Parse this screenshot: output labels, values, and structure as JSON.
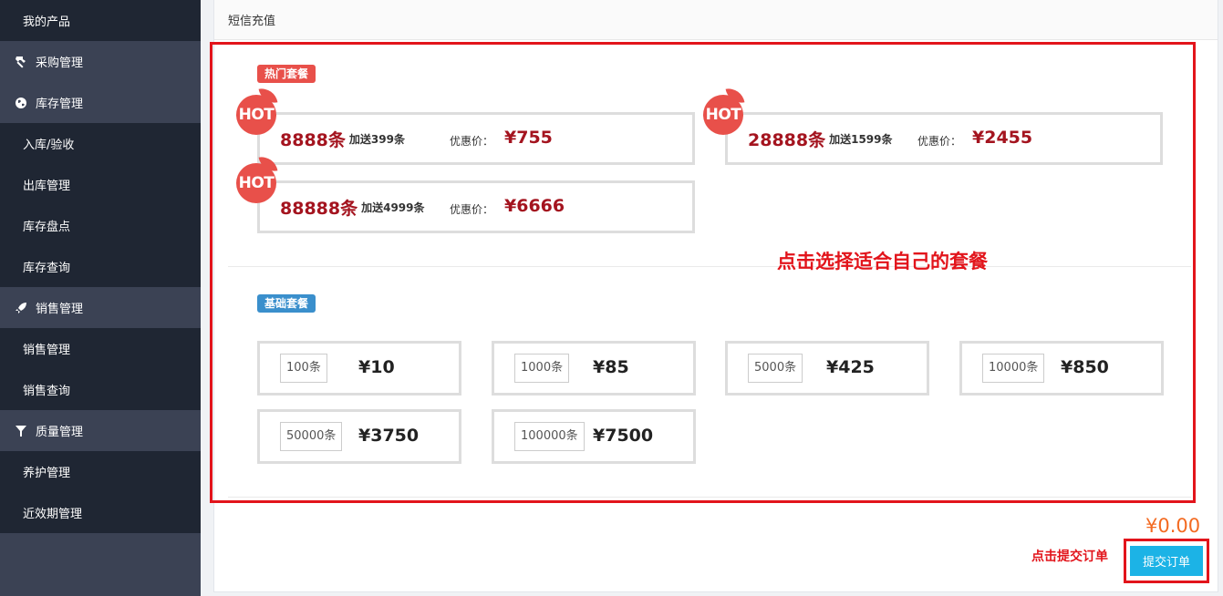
{
  "sidebar": {
    "items": [
      {
        "label": "我的产品",
        "kind": "sub"
      },
      {
        "label": "采购管理",
        "kind": "group",
        "icon": "hammer-icon"
      },
      {
        "label": "库存管理",
        "kind": "group",
        "icon": "globe-icon"
      },
      {
        "label": "入库/验收",
        "kind": "sub"
      },
      {
        "label": "出库管理",
        "kind": "sub"
      },
      {
        "label": "库存盘点",
        "kind": "sub"
      },
      {
        "label": "库存查询",
        "kind": "sub"
      },
      {
        "label": "销售管理",
        "kind": "group",
        "icon": "rocket-icon"
      },
      {
        "label": "销售管理",
        "kind": "sub"
      },
      {
        "label": "销售查询",
        "kind": "sub"
      },
      {
        "label": "质量管理",
        "kind": "group",
        "icon": "filter-icon"
      },
      {
        "label": "养护管理",
        "kind": "sub"
      },
      {
        "label": "近效期管理",
        "kind": "sub"
      }
    ]
  },
  "page": {
    "title": "短信充值",
    "hot_tag": "热门套餐",
    "basic_tag": "基础套餐",
    "hot_badge": "HOT",
    "price_label": "优惠价：",
    "hint_select": "点击选择适合自己的套餐",
    "hint_submit": "点击提交订单",
    "total": "¥0.00",
    "submit_label": "提交订单"
  },
  "hot_packages": [
    {
      "qty": "8888条",
      "bonus": "加送399条",
      "price": "¥755"
    },
    {
      "qty": "28888条",
      "bonus": "加送1599条",
      "price": "¥2455"
    },
    {
      "qty": "88888条",
      "bonus": "加送4999条",
      "price": "¥6666"
    }
  ],
  "basic_packages": [
    {
      "qty": "100条",
      "price": "¥10"
    },
    {
      "qty": "1000条",
      "price": "¥85"
    },
    {
      "qty": "5000条",
      "price": "¥425"
    },
    {
      "qty": "10000条",
      "price": "¥850"
    },
    {
      "qty": "50000条",
      "price": "¥3750"
    },
    {
      "qty": "100000条",
      "price": "¥7500"
    }
  ],
  "colors": {
    "sidebar_group": "#3b4254",
    "sidebar_sub": "#1f2633",
    "annotation_red": "#e2141b",
    "price_red": "#a4141f",
    "hot_badge": "#e8504a",
    "basic_tag": "#3a8fcc",
    "total_orange": "#f36a21",
    "submit_blue": "#1cb3e6"
  }
}
